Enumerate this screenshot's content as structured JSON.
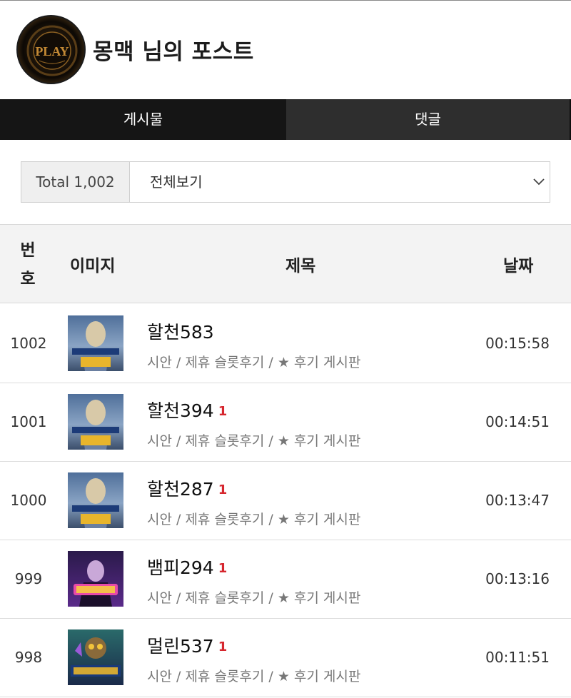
{
  "header": {
    "title": "몽맥 님의 포스트",
    "avatar_logo_text": "PLAY"
  },
  "tabs": [
    {
      "label": "게시물",
      "active": true
    },
    {
      "label": "댓글",
      "active": false
    }
  ],
  "filter": {
    "total": "Total 1,002",
    "select_value": "전체보기"
  },
  "table": {
    "headers": {
      "no": "번호",
      "image": "이미지",
      "title": "제목",
      "date": "날짜"
    },
    "rows": [
      {
        "no": "1002",
        "title": "할천583",
        "count": "",
        "category": "시안 / 제휴 슬롯후기 / ★ 후기 게시판",
        "date": "00:15:58",
        "thumb": "gates-of-olympus"
      },
      {
        "no": "1001",
        "title": "할천394",
        "count": "1",
        "category": "시안 / 제휴 슬롯후기 / ★ 후기 게시판",
        "date": "00:14:51",
        "thumb": "gates-of-olympus"
      },
      {
        "no": "1000",
        "title": "할천287",
        "count": "1",
        "category": "시안 / 제휴 슬롯후기 / ★ 후기 게시판",
        "date": "00:13:47",
        "thumb": "gates-of-olympus"
      },
      {
        "no": "999",
        "title": "뱀피294",
        "count": "1",
        "category": "시안 / 제휴 슬롯후기 / ★ 후기 게시판",
        "date": "00:13:16",
        "thumb": "vampy-party"
      },
      {
        "no": "998",
        "title": "멀린537",
        "count": "1",
        "category": "시안 / 제휴 슬롯후기 / ★ 후기 게시판",
        "date": "00:11:51",
        "thumb": "power-of-merlin"
      }
    ]
  },
  "colors": {
    "tab_active_bg": "#151515",
    "tab_inactive_bg": "#2e2e2e",
    "comment_count": "#d6262e",
    "header_row_bg": "#f3f3f3"
  }
}
